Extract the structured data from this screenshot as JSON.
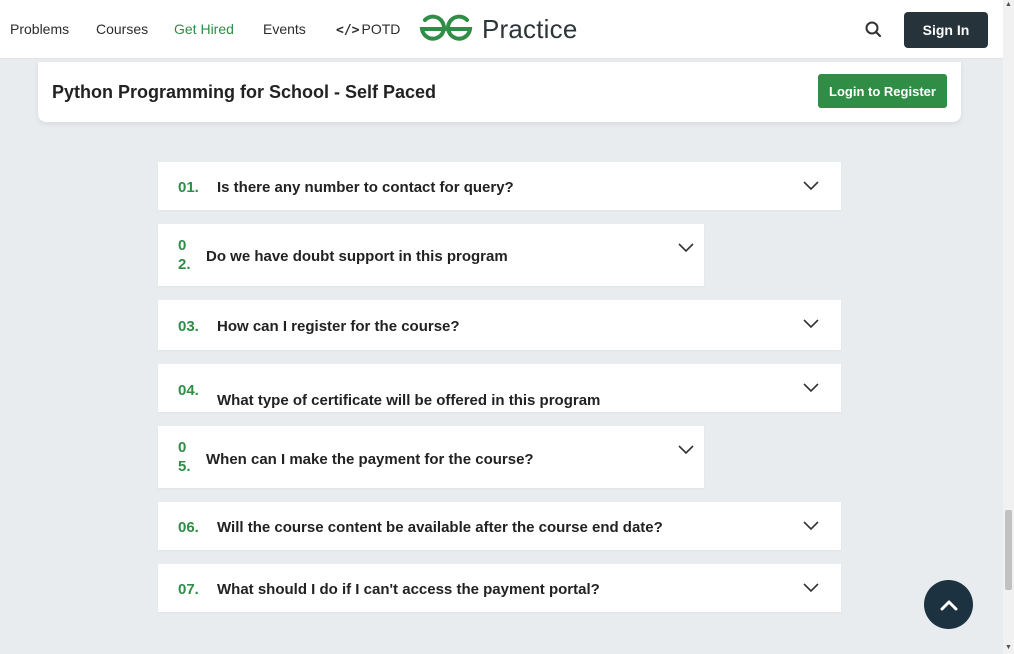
{
  "nav": {
    "links": [
      "Problems",
      "Courses",
      "Get Hired",
      "Events",
      "POTD"
    ],
    "potd_icon": "</>",
    "logo_text": "Practice",
    "brand_color": "#2f8d46",
    "search_icon": "search-icon",
    "signin_label": "Sign In"
  },
  "course": {
    "title": "Python Programming for School - Self Paced",
    "register_label": "Login to Register"
  },
  "faqs": [
    {
      "num": "01.",
      "question": "Is there any number to contact for query?"
    },
    {
      "num": "02.",
      "question": "Do we have doubt support in this program"
    },
    {
      "num": "03.",
      "question": "How can I register for the course?"
    },
    {
      "num": "04.",
      "question": "What type of certificate will be offered in this program"
    },
    {
      "num": "05.",
      "question": "When can I make the payment for the course?"
    },
    {
      "num": "06.",
      "question": "Will the course content be available after the course end date?"
    },
    {
      "num": "07.",
      "question": "What should I do if I can't access the payment portal?"
    }
  ],
  "back_to_top_icon": "chevron-up-icon"
}
